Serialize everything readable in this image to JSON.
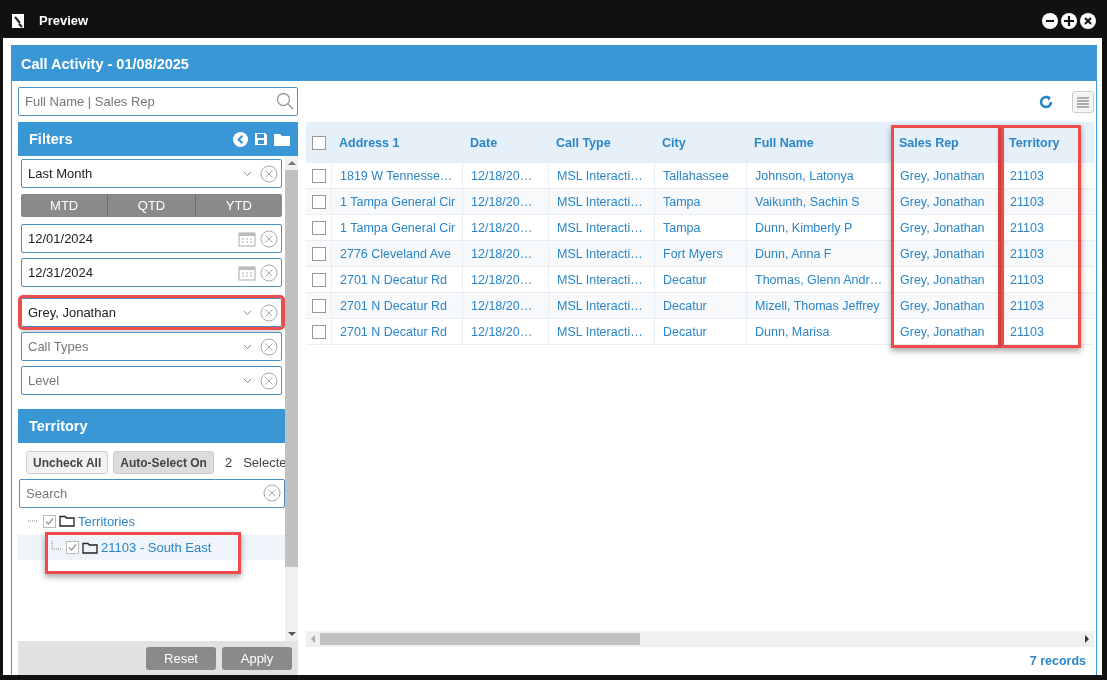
{
  "window": {
    "title": "Preview"
  },
  "panel": {
    "title": "Call Activity - 01/08/2025"
  },
  "search": {
    "placeholder": "Full Name | Sales Rep"
  },
  "filters": {
    "title": "Filters",
    "fields": [
      {
        "kind": "select",
        "value": "Last Month",
        "highlighted": false
      },
      {
        "kind": "segments",
        "options": [
          "MTD",
          "QTD",
          "YTD"
        ]
      },
      {
        "kind": "date",
        "value": "12/01/2024"
      },
      {
        "kind": "date",
        "value": "12/31/2024"
      },
      {
        "kind": "select",
        "value": "Grey, Jonathan",
        "highlighted": true
      },
      {
        "kind": "select",
        "placeholder": "Call Types",
        "highlighted": false
      },
      {
        "kind": "select",
        "placeholder": "Level",
        "highlighted": false
      }
    ]
  },
  "territory": {
    "title": "Territory",
    "buttons": [
      {
        "label": "Uncheck All",
        "on": false
      },
      {
        "label": "Auto-Select On",
        "on": true
      }
    ],
    "selected_count": "2",
    "selected_label": "Selecte",
    "search": {
      "placeholder": "Search"
    },
    "tree": [
      {
        "label": "Territories",
        "checked": true,
        "expanded": true,
        "selected": false,
        "children": [
          {
            "label": "21103 - South East",
            "checked": true,
            "selected": true,
            "highlighted": true
          }
        ]
      }
    ]
  },
  "footer_buttons": [
    "Reset",
    "Apply"
  ],
  "table": {
    "all_checked": false,
    "columns": [
      {
        "label": "Address 1",
        "highlighted": false
      },
      {
        "label": "Date",
        "highlighted": false
      },
      {
        "label": "Call Type",
        "highlighted": false
      },
      {
        "label": "City",
        "highlighted": false
      },
      {
        "label": "Full Name",
        "highlighted": false
      },
      {
        "label": "Sales Rep",
        "highlighted": true
      },
      {
        "label": "Territory",
        "highlighted": true
      }
    ],
    "rows": [
      {
        "checked": false,
        "cells": [
          "1819 W Tennesse…",
          "12/18/20…",
          "MSL Interacti…",
          "Tallahassee",
          "Johnson, Latonya",
          "Grey, Jonathan",
          "21103"
        ]
      },
      {
        "checked": false,
        "cells": [
          "1 Tampa General Cir",
          "12/18/20…",
          "MSL Interacti…",
          "Tampa",
          "Vaikunth, Sachin S",
          "Grey, Jonathan",
          "21103"
        ]
      },
      {
        "checked": false,
        "cells": [
          "1 Tampa General Cir",
          "12/18/20…",
          "MSL Interacti…",
          "Tampa",
          "Dunn, Kimberly P",
          "Grey, Jonathan",
          "21103"
        ]
      },
      {
        "checked": false,
        "cells": [
          "2776 Cleveland Ave",
          "12/18/20…",
          "MSL Interacti…",
          "Fort Myers",
          "Dunn, Anna F",
          "Grey, Jonathan",
          "21103"
        ]
      },
      {
        "checked": false,
        "cells": [
          "2701 N Decatur Rd",
          "12/18/20…",
          "MSL Interacti…",
          "Decatur",
          "Thomas, Glenn Andr…",
          "Grey, Jonathan",
          "21103"
        ]
      },
      {
        "checked": false,
        "cells": [
          "2701 N Decatur Rd",
          "12/18/20…",
          "MSL Interacti…",
          "Decatur",
          "Mizell, Thomas Jeffrey",
          "Grey, Jonathan",
          "21103"
        ]
      },
      {
        "checked": false,
        "cells": [
          "2701 N Decatur Rd",
          "12/18/20…",
          "MSL Interacti…",
          "Decatur",
          "Dunn, Marisa",
          "Grey, Jonathan",
          "21103"
        ]
      }
    ],
    "records": "7 records"
  }
}
